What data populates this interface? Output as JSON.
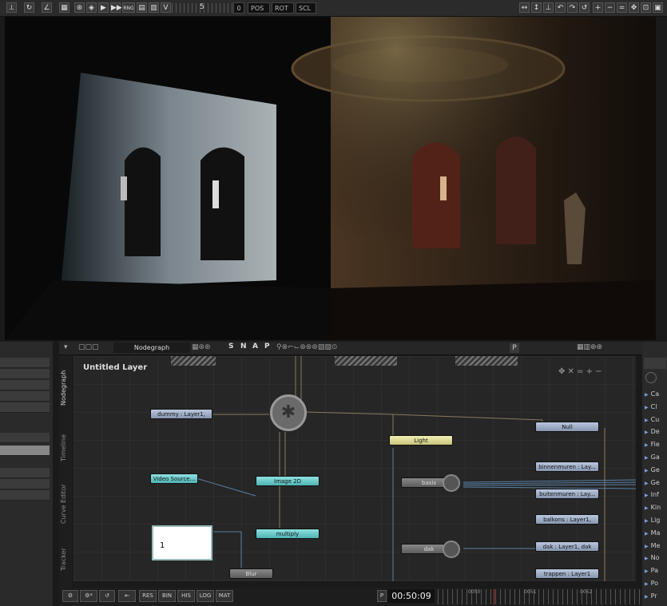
{
  "toolbar": {
    "timecode_small": "5",
    "counter": "0",
    "tabs": [
      "POS",
      "ROT",
      "SCL"
    ],
    "render_btn": "RNG"
  },
  "nodegraph": {
    "title": "Nodegraph",
    "snap_letters": [
      "S",
      "N",
      "A",
      "P"
    ],
    "layer_title": "Untitled  Layer",
    "p_label": "P",
    "vtabs": [
      "Nodegraph",
      "Timeline",
      "Curve Editor",
      "Tracker"
    ],
    "nodes": {
      "dummy": "dummy : Layer1,",
      "video_source": "Video Source...",
      "image2d": "Image 2D",
      "multiply": "multiply",
      "light": "Light",
      "null": "Null",
      "basis": "basis",
      "dak": "dak",
      "binnenmuren": "binnenmuren : Lay...",
      "buitenmuren": "buitenmuren : Lay...",
      "balkons": "balkons : Layer1,",
      "dak_layer": "dak : Layer1, dak",
      "trap": "trappen : Layer1",
      "blur": "Blur",
      "value_box": "1"
    }
  },
  "bottom": {
    "buttons": [
      "RES",
      "BIN",
      "HIS",
      "LOG",
      "MAT"
    ],
    "p_label": "P",
    "timecode": "00:50:09",
    "ticks": [
      "0050",
      "0051",
      "0052"
    ]
  },
  "right_list": [
    "Ca",
    "Cl",
    "Cu",
    "De",
    "Fie",
    "Ga",
    "Ge",
    "Ge",
    "Inf",
    "Kin",
    "Lig",
    "Ma",
    "Me",
    "No",
    "Pa",
    "Po",
    "Pr"
  ],
  "colors": {
    "node_blue": "#9fb0cc",
    "node_cyan": "#6fcfcf",
    "node_yellow": "#e0dd9a",
    "playhead": "#d12b2b"
  }
}
